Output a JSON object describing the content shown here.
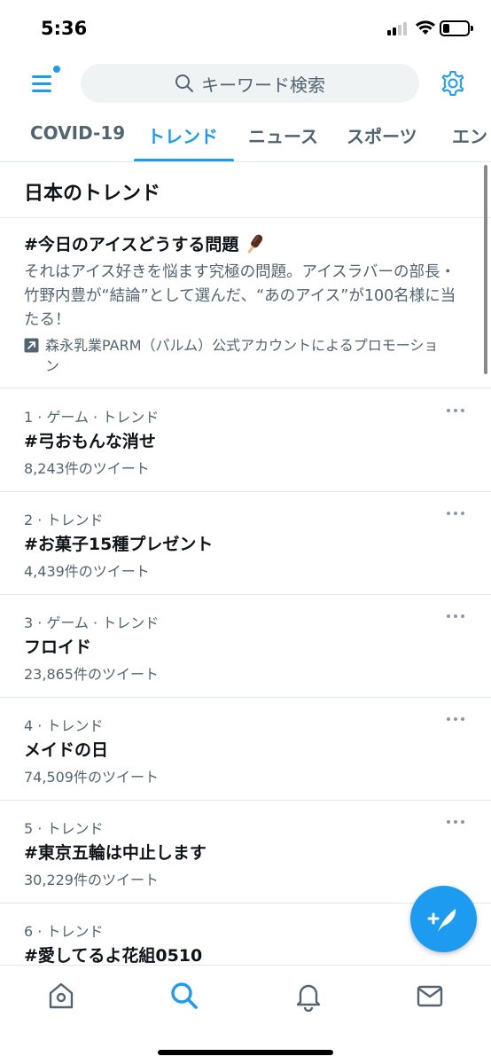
{
  "status_bar": {
    "time": "5:36"
  },
  "colors": {
    "accent": "#1d9bf0",
    "muted": "#536471",
    "divider": "#e1e8ed"
  },
  "header": {
    "search_placeholder": "キーワード検索"
  },
  "tabs": [
    {
      "label": "COVID-19",
      "active": false
    },
    {
      "label": "トレンド",
      "active": true
    },
    {
      "label": "ニュース",
      "active": false
    },
    {
      "label": "スポーツ",
      "active": false
    },
    {
      "label": "エン",
      "active": false
    }
  ],
  "section": {
    "title": "日本のトレンド"
  },
  "promoted": {
    "title": "#今日のアイスどうする問題",
    "icon": "ice-cream-bar-emoji",
    "description": "それはアイス好きを悩ます究極の問題。アイスラバーの部長・竹野内豊が“結論”として選んだ、“あのアイス”が100名様に当たる！",
    "promoted_by": "森永乳業PARM（パルム）公式アカウントによるプロモーション",
    "promoted_icon": "promoted-arrow-icon"
  },
  "trends": [
    {
      "context": "1 · ゲーム · トレンド",
      "name": "#弓おもんな消せ",
      "count": "8,243件のツイート"
    },
    {
      "context": "2 · トレンド",
      "name": "#お菓子15種プレゼント",
      "count": "4,439件のツイート"
    },
    {
      "context": "3 · ゲーム · トレンド",
      "name": "フロイド",
      "count": "23,865件のツイート"
    },
    {
      "context": "4 · トレンド",
      "name": "メイドの日",
      "count": "74,509件のツイート"
    },
    {
      "context": "5 · トレンド",
      "name": "#東京五輪は中止します",
      "count": "30,229件のツイート"
    },
    {
      "context": "6 · トレンド",
      "name": "#愛してるよ花組0510",
      "count": ""
    }
  ],
  "bottom_nav": [
    {
      "icon": "home-icon",
      "active": false
    },
    {
      "icon": "search-icon",
      "active": true
    },
    {
      "icon": "notifications-bell-icon",
      "active": false
    },
    {
      "icon": "messages-envelope-icon",
      "active": false
    }
  ]
}
